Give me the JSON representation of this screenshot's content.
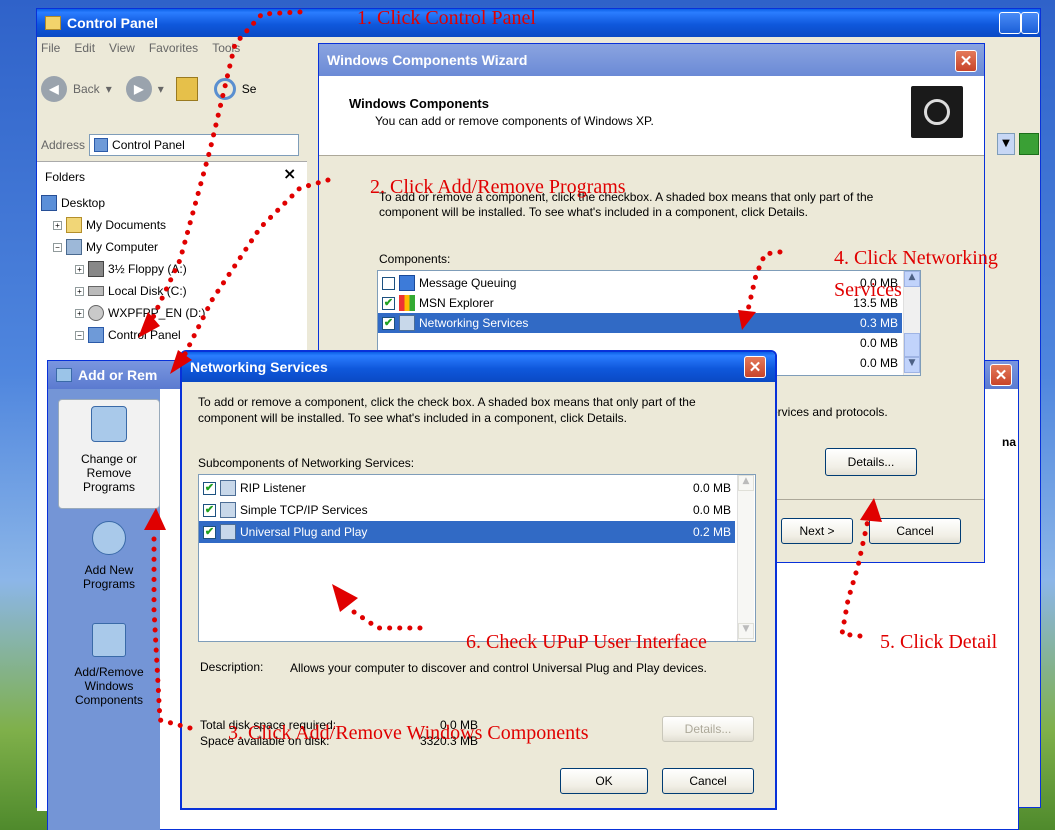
{
  "control_panel": {
    "title": "Control Panel",
    "menu": [
      "File",
      "Edit",
      "View",
      "Favorites",
      "Tools"
    ],
    "back_label": "Back",
    "search_label": "Se",
    "address_label": "Address",
    "address_value": "Control Panel",
    "folders_label": "Folders",
    "close_glyph": "×",
    "tree": {
      "desktop": "Desktop",
      "my_documents": "My Documents",
      "my_computer": "My Computer",
      "floppy": "3½ Floppy (A:)",
      "local_disk": "Local Disk (C:)",
      "wxpfpp": "WXPFPP_EN (D:)",
      "control_panel": "Control Panel"
    }
  },
  "add_remove": {
    "title": "Add or Rem",
    "items": {
      "change_remove": "Change or Remove Programs",
      "add_new": "Add New Programs",
      "add_remove_windows": "Add/Remove Windows Components"
    },
    "side_text": "na"
  },
  "wizard": {
    "title": "Windows Components Wizard",
    "header_title": "Windows Components",
    "header_sub": "You can add or remove components of Windows XP.",
    "intro": "To add or remove a component, click the checkbox. A shaded box means that only part of the component will be installed. To see what's included in a component, click Details.",
    "components_label": "Components:",
    "components": [
      {
        "name": "Message Queuing",
        "size": "0.0 MB",
        "checked": false
      },
      {
        "name": "MSN Explorer",
        "size": "13.5 MB",
        "checked": true
      },
      {
        "name": "Networking Services",
        "size": "0.3 MB",
        "checked": true
      },
      {
        "name": "",
        "size": "0.0 MB",
        "checked": false
      },
      {
        "name": "",
        "size": "0.0 MB",
        "checked": false
      }
    ],
    "desc_partial": "ervices and protocols.",
    "details_label": "Details...",
    "next_label": "Next >",
    "cancel_label": "Cancel"
  },
  "networking": {
    "title": "Networking Services",
    "intro": "To add or remove a component, click the check box. A shaded box means that only part of the component will be installed. To see what's included in a component, click Details.",
    "sub_label": "Subcomponents of Networking Services:",
    "items": [
      {
        "name": "RIP Listener",
        "size": "0.0 MB",
        "checked": true
      },
      {
        "name": "Simple TCP/IP Services",
        "size": "0.0 MB",
        "checked": true
      },
      {
        "name": "Universal Plug and Play",
        "size": "0.2 MB",
        "checked": true
      }
    ],
    "description_label": "Description:",
    "description_text": "Allows your computer to discover and control Universal Plug and Play devices.",
    "total_label": "Total disk space required:",
    "total_value": "0.0 MB",
    "avail_label": "Space available on disk:",
    "avail_value": "3320.3 MB",
    "details_label": "Details...",
    "ok_label": "OK",
    "cancel_label": "Cancel"
  },
  "annotations": {
    "step1": "1. Click Control Panel",
    "step2": "2. Click Add/Remove Programs",
    "step3": "3. Click Add/Remove Windows Components",
    "step4a": "4. Click Networking",
    "step4b": "Services",
    "step5": "5. Click Detail",
    "step6": "6. Check UPuP User Interface"
  },
  "colors": {
    "annotation": "#e00000",
    "xp_titlebar": "#0a5fe6",
    "selection": "#316ac5"
  }
}
